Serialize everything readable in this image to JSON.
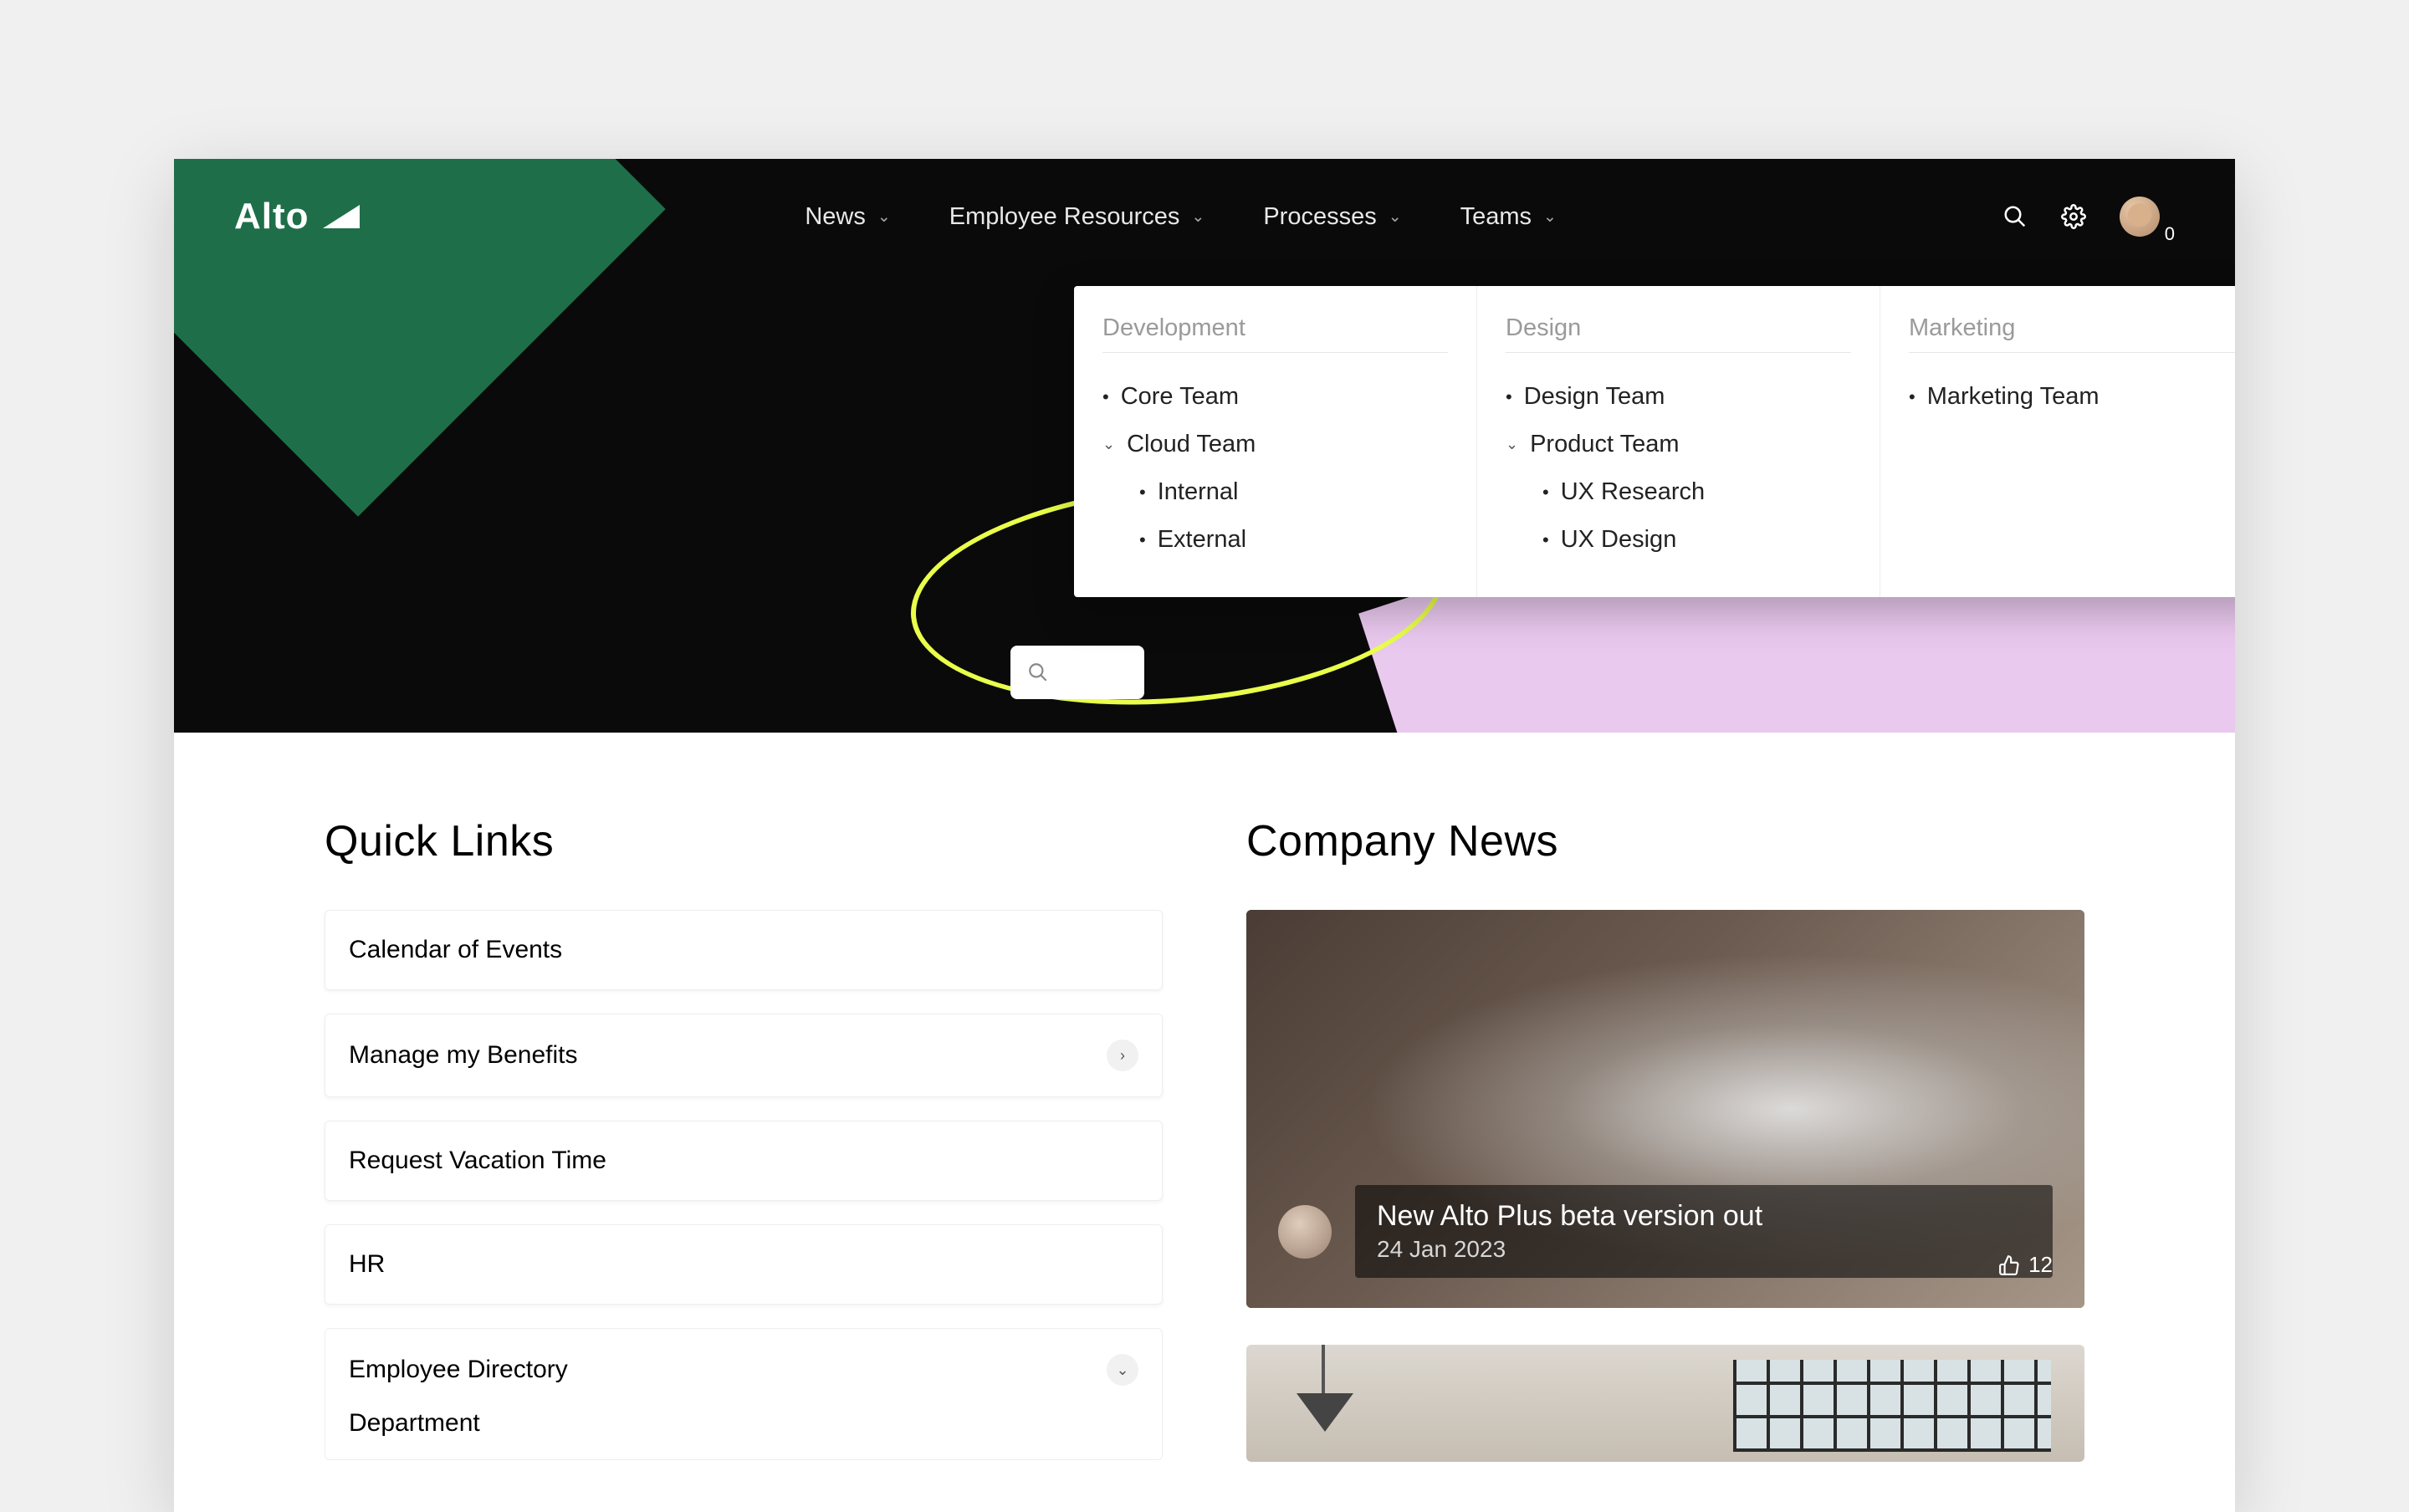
{
  "brand": {
    "name": "Alto"
  },
  "nav": {
    "items": [
      {
        "label": "News"
      },
      {
        "label": "Employee Resources"
      },
      {
        "label": "Processes"
      },
      {
        "label": "Teams"
      }
    ]
  },
  "notifications": {
    "count": "0"
  },
  "mega": {
    "columns": [
      {
        "heading": "Development",
        "items": [
          {
            "label": "Core Team",
            "type": "leaf"
          },
          {
            "label": "Cloud Team",
            "type": "expandable"
          },
          {
            "label": "Internal",
            "type": "sub"
          },
          {
            "label": "External",
            "type": "sub"
          }
        ]
      },
      {
        "heading": "Design",
        "items": [
          {
            "label": "Design Team",
            "type": "leaf"
          },
          {
            "label": "Product Team",
            "type": "expandable"
          },
          {
            "label": "UX Research",
            "type": "sub"
          },
          {
            "label": "UX Design",
            "type": "sub"
          }
        ]
      },
      {
        "heading": "Marketing",
        "items": [
          {
            "label": "Marketing Team",
            "type": "leaf"
          }
        ]
      }
    ]
  },
  "quick_links": {
    "title": "Quick Links",
    "items": [
      {
        "label": "Calendar of Events",
        "expandable": false
      },
      {
        "label": "Manage my Benefits",
        "expandable": true,
        "icon": "right"
      },
      {
        "label": "Request Vacation Time",
        "expandable": false
      },
      {
        "label": "HR",
        "expandable": false
      },
      {
        "label": "Employee Directory",
        "expandable": true,
        "icon": "down",
        "expanded": true
      },
      {
        "label": "Department",
        "parent": 4
      }
    ]
  },
  "news": {
    "title": "Company News",
    "posts": [
      {
        "title": "New Alto Plus beta version out",
        "date": "24 Jan 2023",
        "likes": "12"
      }
    ]
  }
}
